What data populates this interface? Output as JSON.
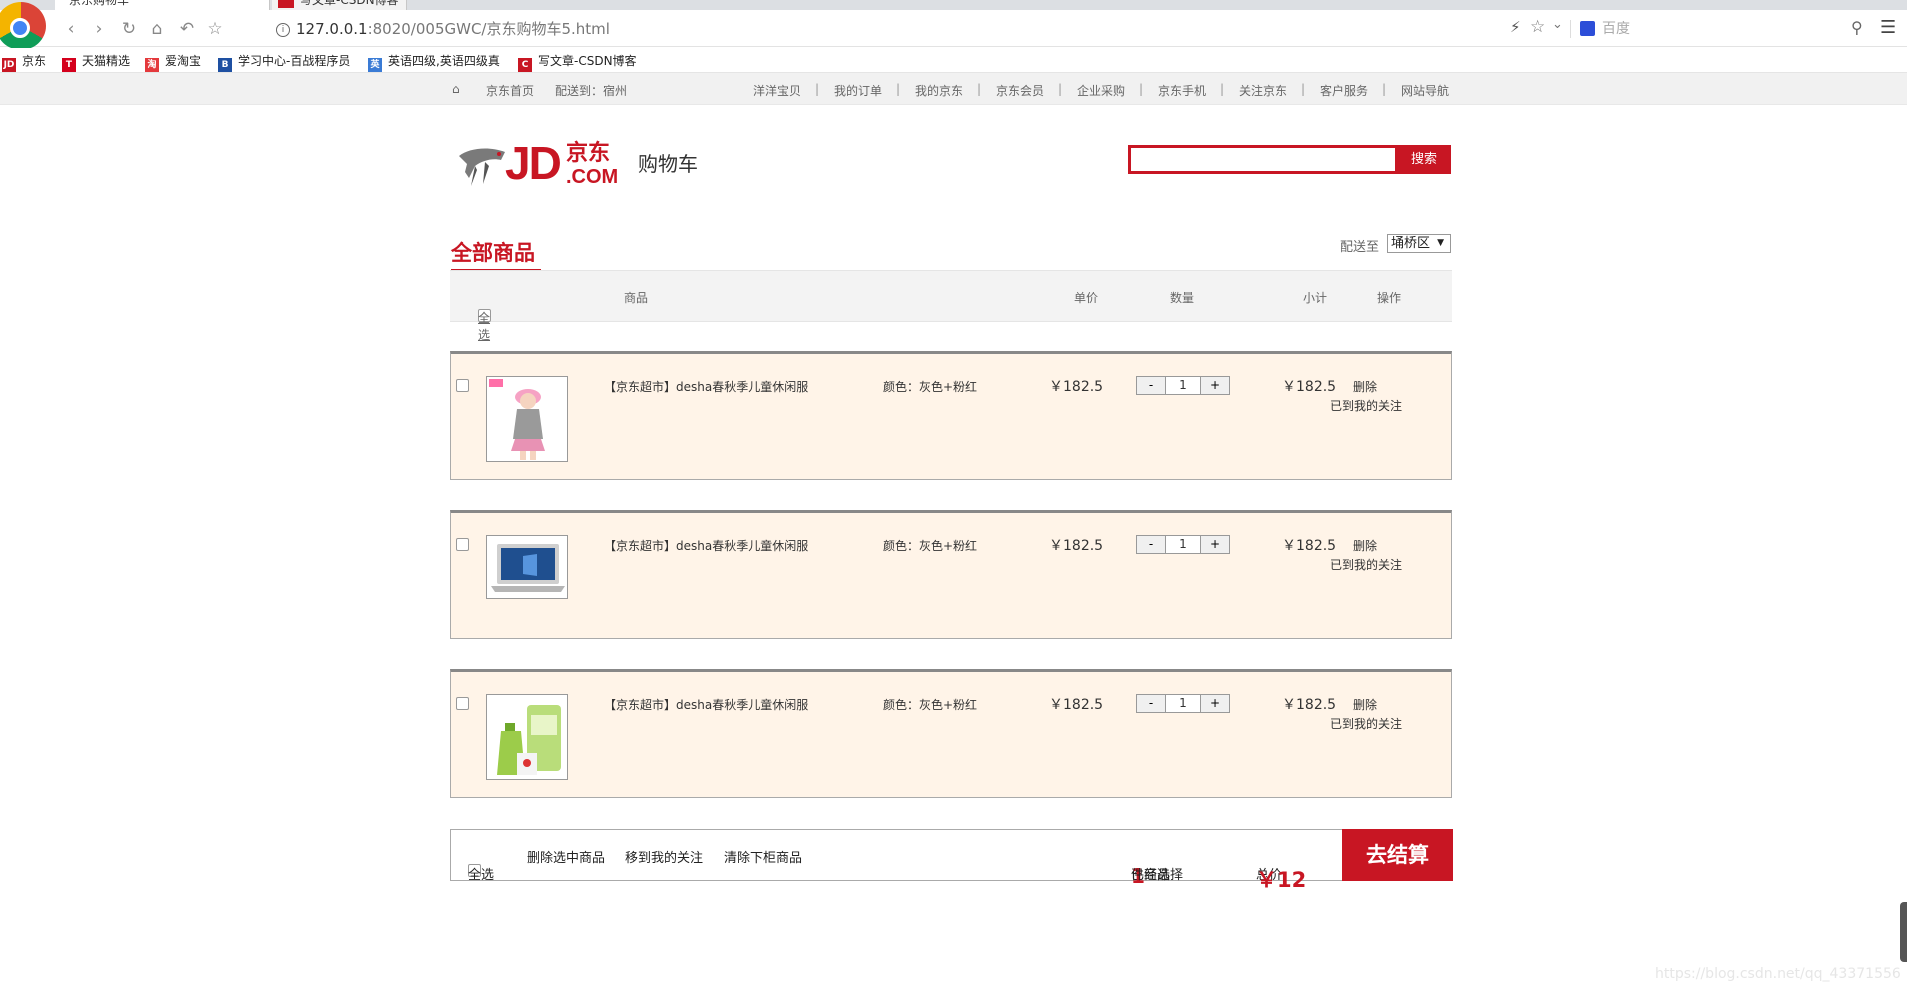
{
  "browser": {
    "tabs": [
      {
        "title": "京东购物车"
      },
      {
        "title": "写文章-CSDN博客"
      }
    ],
    "url_host": "127.0.0.1",
    "url_rest": ":8020/005GWC/京东购物车5.html",
    "search_placeholder": "百度",
    "bookmarks": [
      {
        "label": "京东",
        "icon": "jd-icon",
        "color": "#c81623"
      },
      {
        "label": "天猫精选",
        "icon": "tmall-icon",
        "color": "#d4001c"
      },
      {
        "label": "爱淘宝",
        "icon": "taobao-icon",
        "color": "#e4393c"
      },
      {
        "label": "学习中心-百战程序员",
        "icon": "learning-icon",
        "color": "#1e50a2"
      },
      {
        "label": "英语四级,英语四级真",
        "icon": "english-icon",
        "color": "#3a7bd5"
      },
      {
        "label": "写文章-CSDN博客",
        "icon": "csdn-icon",
        "color": "#c81623"
      }
    ]
  },
  "jd_nav": {
    "home": "京东首页",
    "ship_to": "配送到：宿州",
    "links": [
      "洋洋宝贝",
      "我的订单",
      "我的京东",
      "京东会员",
      "企业采购",
      "京东手机",
      "关注京东",
      "客户服务",
      "网站导航"
    ]
  },
  "header": {
    "logo_letters": "JD",
    "logo_cn": "京东",
    "logo_com": ".COM",
    "title": "购物车",
    "search_button": "搜索",
    "search_value": ""
  },
  "cart": {
    "all_goods": "全部商品",
    "ship_label": "配送至",
    "region": "埇桥区",
    "columns": {
      "select_all": "全选",
      "product": "商品",
      "unit_price": "单价",
      "quantity": "数量",
      "subtotal": "小计",
      "action": "操作"
    },
    "items": [
      {
        "name": "【京东超市】desha春秋季儿童休闲服",
        "color": "颜色：灰色+粉红",
        "price": "￥182.5",
        "qty": "1",
        "subtotal": "￥182.5",
        "delete": "删除",
        "favorite": "已到我的关注",
        "image": "girl-clothes-image"
      },
      {
        "name": "【京东超市】desha春秋季儿童休闲服",
        "color": "颜色：灰色+粉红",
        "price": "￥182.5",
        "qty": "1",
        "subtotal": "￥182.5",
        "delete": "删除",
        "favorite": "已到我的关注",
        "image": "laptop-image"
      },
      {
        "name": "【京东超市】desha春秋季儿童休闲服",
        "color": "颜色：灰色+粉红",
        "price": "￥182.5",
        "qty": "1",
        "subtotal": "￥182.5",
        "delete": "删除",
        "favorite": "已到我的关注",
        "image": "detergent-image"
      }
    ],
    "qty_minus": "-",
    "qty_plus": "+"
  },
  "footer": {
    "select_all": "全选",
    "delete_selected": "删除选中商品",
    "move_to_favorites": "移到我的关注",
    "clear_items": "清除下柜商品",
    "selected_prefix": "已经选择",
    "selected_count": "1",
    "selected_suffix": "件商品",
    "total_label": "总价",
    "total_value": "￥12",
    "checkout": "去结算"
  },
  "watermark": "https://blog.csdn.net/qq_43371556",
  "colors": {
    "brand_red": "#c81623",
    "item_bg": "#fff4e8"
  }
}
